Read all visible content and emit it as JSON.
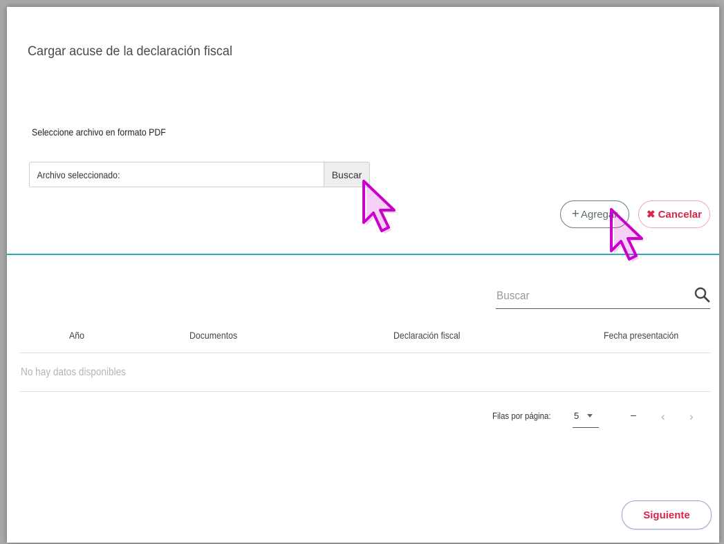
{
  "dialog": {
    "title": "Cargar acuse de la declaración fiscal",
    "file_instruction": "Seleccione archivo en formato PDF",
    "file_label": "Archivo seleccionado:",
    "browse_label": "Buscar",
    "add_label": "Agregar",
    "cancel_label": "Cancelar"
  },
  "table": {
    "search_placeholder": "Buscar",
    "columns": [
      "Año",
      "Documentos",
      "Declaración fiscal",
      "Fecha presentación"
    ],
    "empty_message": "No hay datos disponibles",
    "pagination": {
      "rows_per_page_label": "Filas por página:",
      "rows_per_page_value": "5",
      "range_text": "–",
      "prev_symbol": "‹",
      "next_symbol": "›"
    }
  },
  "footer": {
    "next_label": "Siguiente"
  },
  "icons": [
    "search-icon",
    "plus-icon",
    "close-icon",
    "chevron-down-icon",
    "chevron-left-icon",
    "chevron-right-icon",
    "mouse-pointer-icon"
  ],
  "colors": {
    "accent": "#2aa7c3",
    "danger": "#d5264a",
    "cursor_annotation": "#cc00cc"
  }
}
